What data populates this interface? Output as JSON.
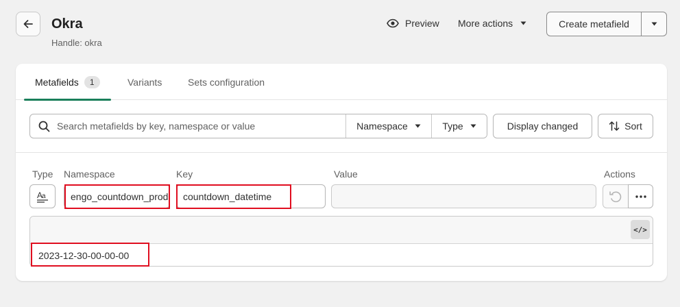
{
  "header": {
    "title": "Okra",
    "handle": "Handle: okra",
    "preview_label": "Preview",
    "more_actions_label": "More actions",
    "create_label": "Create metafield"
  },
  "tabs": [
    {
      "label": "Metafields",
      "count": "1",
      "active": true
    },
    {
      "label": "Variants"
    },
    {
      "label": "Sets configuration"
    }
  ],
  "filters": {
    "search_placeholder": "Search metafields by key, namespace or value",
    "namespace_label": "Namespace",
    "type_label": "Type",
    "display_changed_label": "Display changed",
    "sort_label": "Sort"
  },
  "columns": {
    "type": "Type",
    "namespace": "Namespace",
    "key": "Key",
    "value": "Value",
    "actions": "Actions"
  },
  "row": {
    "namespace": "engo_countdown_product",
    "key": "countdown_datetime",
    "value": "",
    "editor_value": "2023-12-30-00-00-00"
  },
  "colors": {
    "accent": "#1a7f5a",
    "highlight": "#e00d1f"
  }
}
